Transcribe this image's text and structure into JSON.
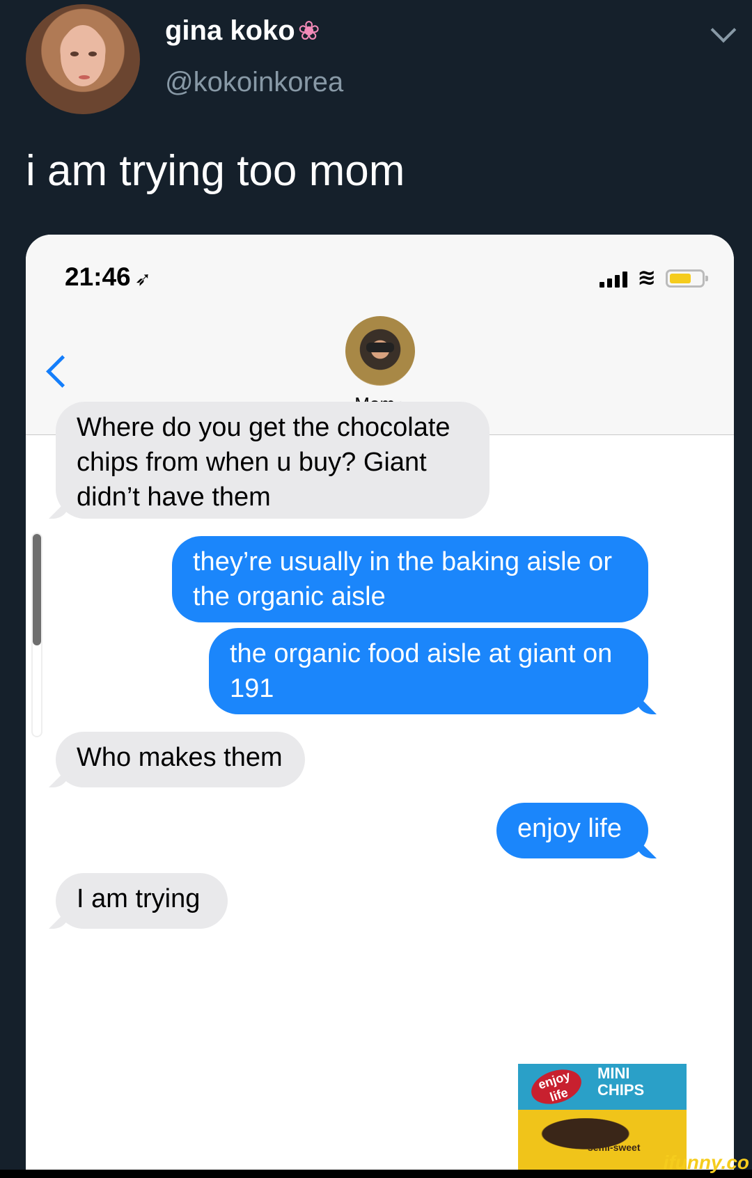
{
  "tweet": {
    "author_name": "gina koko",
    "author_emoji": "❀",
    "author_handle": "@kokoinkorea",
    "text": "i am trying too mom"
  },
  "phone": {
    "status_time": "21:46",
    "location_icon": "location-arrow-icon",
    "contact_name": "Mom",
    "contact_chevron": "›"
  },
  "messages": [
    {
      "from": "received",
      "text": "Where do you get the chocolate chips from when u buy?  Giant didn’t have them"
    },
    {
      "from": "sent",
      "text": "they’re usually in the baking aisle or the organic aisle"
    },
    {
      "from": "sent",
      "text": "the organic food aisle at giant on 191"
    },
    {
      "from": "received",
      "text": "Who makes them"
    },
    {
      "from": "sent",
      "text": "enjoy life"
    },
    {
      "from": "received",
      "text": "I am trying"
    }
  ],
  "attachment": {
    "brand": "enjoy life",
    "product_line1": "MINI",
    "product_line2": "CHIPS",
    "variant": "semi-sweet"
  },
  "watermark": "ifunny.co",
  "colors": {
    "background": "#15202b",
    "sent_bubble": "#1b86fb",
    "received_bubble": "#e9e9eb",
    "ios_blue": "#147efb"
  }
}
